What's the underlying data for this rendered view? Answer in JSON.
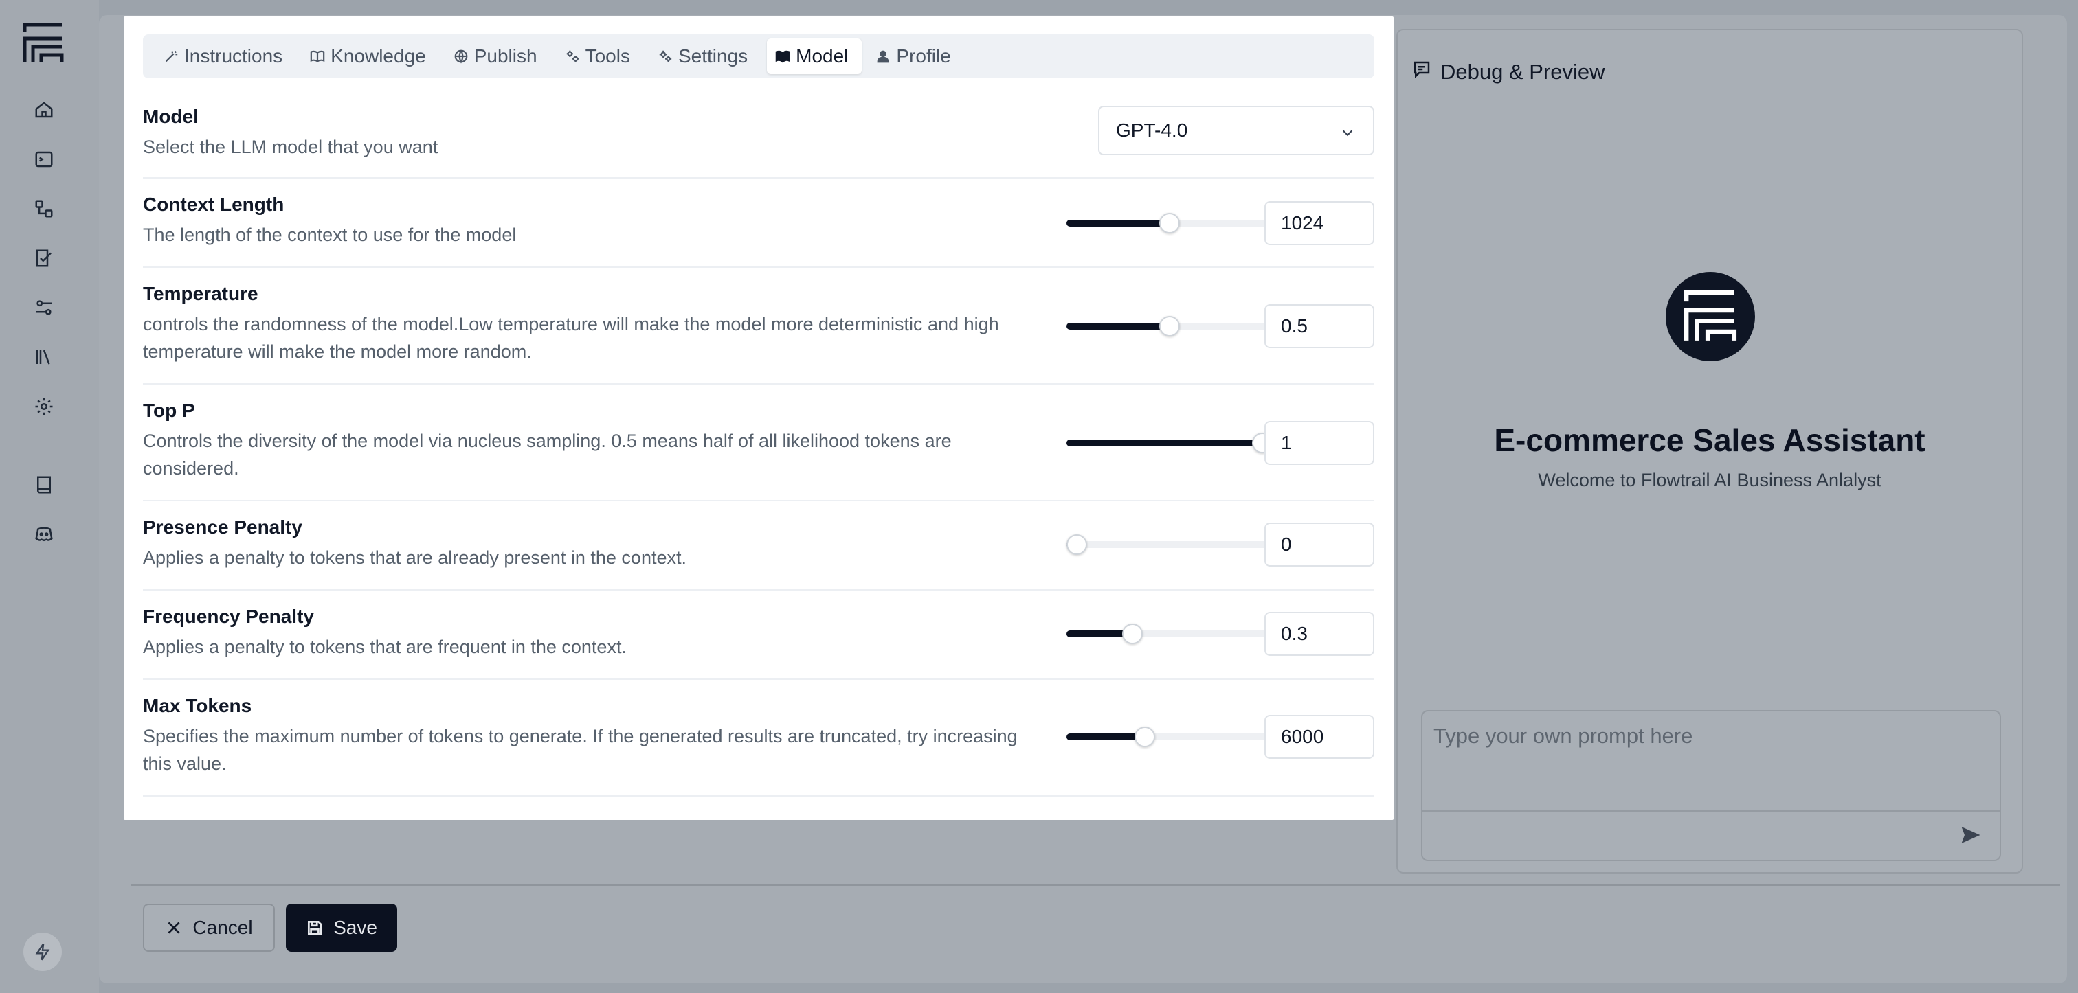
{
  "tabs": [
    {
      "label": "Instructions",
      "icon": "wand-icon"
    },
    {
      "label": "Knowledge",
      "icon": "book-icon"
    },
    {
      "label": "Publish",
      "icon": "globe-icon"
    },
    {
      "label": "Tools",
      "icon": "tools-icon"
    },
    {
      "label": "Settings",
      "icon": "gear-icon"
    },
    {
      "label": "Model",
      "icon": "book-open-icon",
      "active": true
    },
    {
      "label": "Profile",
      "icon": "user-icon"
    }
  ],
  "model": {
    "label": "Model",
    "description": "Select the LLM model that you want",
    "selected": "GPT-4.0"
  },
  "params": [
    {
      "label": "Context Length",
      "description": "The length of the context to use for the model",
      "value": "1024",
      "fraction": 0.5
    },
    {
      "label": "Temperature",
      "description": "controls the randomness of the model.Low temperature will make the model more deterministic and high temperature will make the model more random.",
      "value": "0.5",
      "fraction": 0.5
    },
    {
      "label": "Top P",
      "description": "Controls the diversity of the model via nucleus sampling. 0.5 means half of all likelihood tokens are considered.",
      "value": "1",
      "fraction": 0.95
    },
    {
      "label": "Presence Penalty",
      "description": "Applies a penalty to tokens that are already present in the context.",
      "value": "0",
      "fraction": 0.05
    },
    {
      "label": "Frequency Penalty",
      "description": "Applies a penalty to tokens that are frequent in the context.",
      "value": "0.3",
      "fraction": 0.32
    },
    {
      "label": "Max Tokens",
      "description": "Specifies the maximum number of tokens to generate. If the generated results are truncated, try increasing this value.",
      "value": "6000",
      "fraction": 0.38
    }
  ],
  "footer": {
    "cancel": "Cancel",
    "save": "Save"
  },
  "preview": {
    "title": "Debug & Preview",
    "agent_name": "E-commerce Sales Assistant",
    "welcome": "Welcome to Flowtrail AI Business Anlalyst",
    "prompt_placeholder": "Type your own prompt here"
  },
  "colors": {
    "accent": "#0b1120",
    "overlay": "#9ca3ab"
  }
}
